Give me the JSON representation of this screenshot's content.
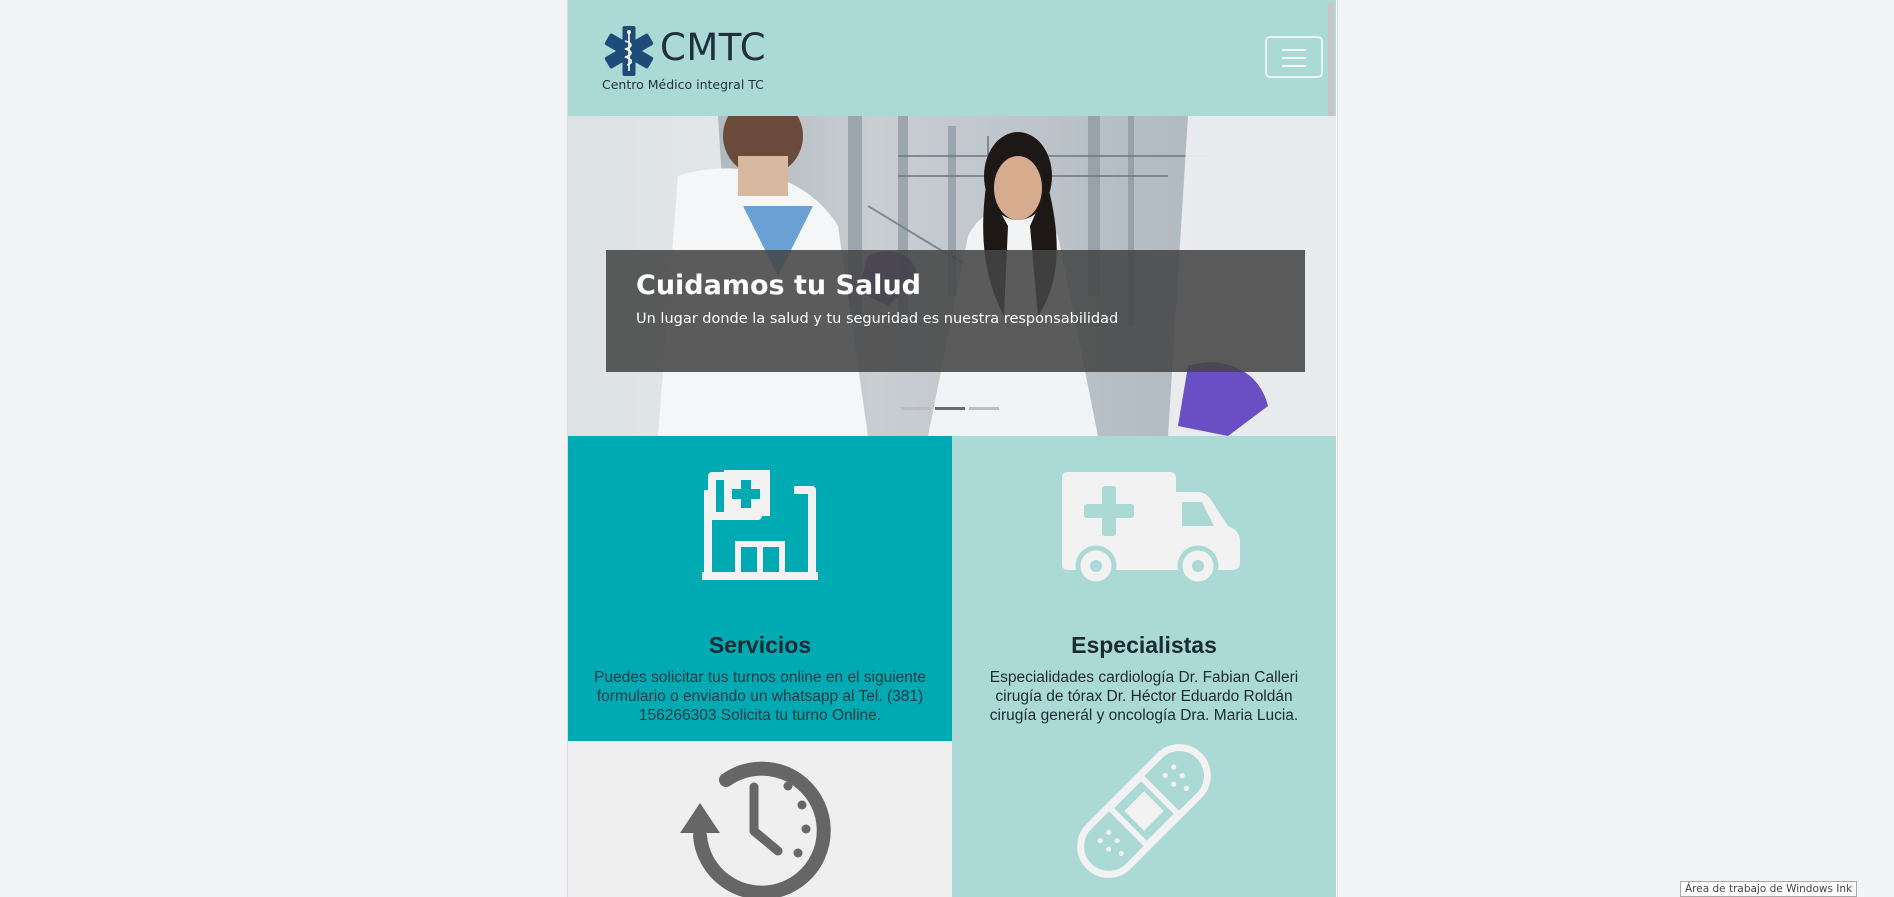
{
  "navbar": {
    "brand_name": "CMTC",
    "brand_subtitle": "Centro Médico integral TC",
    "logo_icon": "star-of-life-icon",
    "menu_icon": "hamburger-icon",
    "background": "#abd9d5"
  },
  "carousel": {
    "slide_title": "Cuidamos tu Salud",
    "slide_text": "Un lugar donde la salud y tu seguridad es nuestra responsabilidad",
    "indicator_count": 3,
    "active_indicator": 2
  },
  "tiles": [
    {
      "icon": "hospital-icon",
      "title": "Servicios",
      "text": "Puedes solicitar tus turnos online en el siguiente formulario o enviando un whatsapp al Tel. (381) 156266303 Solicita tu turno Online.",
      "background": "#00aab2"
    },
    {
      "icon": "ambulance-icon",
      "title": "Especialistas",
      "text": "Especialidades cardiología Dr. Fabian Calleri cirugía de tórax Dr. Héctor Eduardo Roldán cirugía generál y oncología Dra. Maria Lucia.",
      "background": "#abd9d5"
    },
    {
      "icon": "clock-history-icon",
      "title": "",
      "text": "",
      "background": "#efefef"
    },
    {
      "icon": "bandage-icon",
      "title": "",
      "text": "",
      "background": "#abd9d5"
    }
  ],
  "windows_ink_label": "Área de trabajo de Windows Ink"
}
